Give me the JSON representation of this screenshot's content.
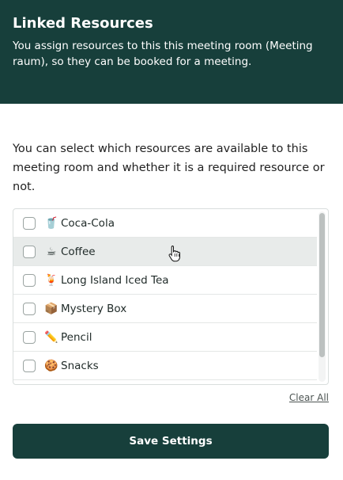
{
  "header": {
    "title": "Linked Resources",
    "description": "You assign resources to this this meeting room (Meeting raum), so they can be booked for a meeting."
  },
  "intro": "You can select which resources are available to this meeting room and whether it is a required resource or not.",
  "resources": [
    {
      "emoji": "🥤",
      "label": "Coca-Cola",
      "checked": false
    },
    {
      "emoji": "☕",
      "label": "Coffee",
      "checked": false
    },
    {
      "emoji": "🍹",
      "label": "Long Island Iced Tea",
      "checked": false
    },
    {
      "emoji": "📦",
      "label": "Mystery Box",
      "checked": false
    },
    {
      "emoji": "✏️",
      "label": "Pencil",
      "checked": false
    },
    {
      "emoji": "🍪",
      "label": "Snacks",
      "checked": false
    }
  ],
  "clear_all_label": "Clear All",
  "save_label": "Save Settings",
  "colors": {
    "brand": "#173f3b",
    "hover_row": "#e8ebea"
  }
}
